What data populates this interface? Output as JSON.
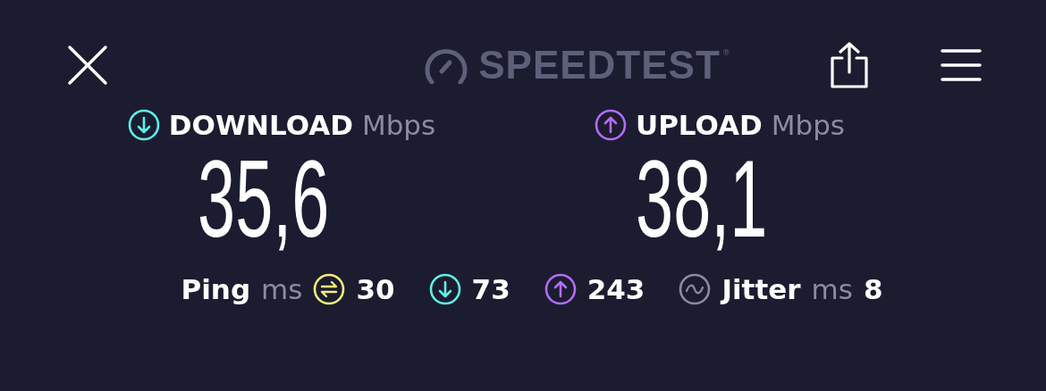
{
  "header": {
    "logo": "SPEEDTEST",
    "trademark": "®"
  },
  "results": [
    {
      "kind": "download",
      "label": "DOWNLOAD",
      "unit": "Mbps",
      "value": "35,6",
      "color": "#5ef1e8"
    },
    {
      "kind": "upload",
      "label": "UPLOAD",
      "unit": "Mbps",
      "value": "38,1",
      "color": "#b56cf4"
    }
  ],
  "stats": {
    "ping_label": "Ping",
    "ping_unit": "ms",
    "items": [
      {
        "kind": "idle",
        "value": "30",
        "color": "#f6ee79"
      },
      {
        "kind": "download",
        "value": "73",
        "color": "#5ef1e8"
      },
      {
        "kind": "upload",
        "value": "243",
        "color": "#b56cf4"
      }
    ],
    "jitter": {
      "label": "Jitter",
      "unit": "ms",
      "value": "8",
      "color": "#8b8c9e"
    }
  }
}
